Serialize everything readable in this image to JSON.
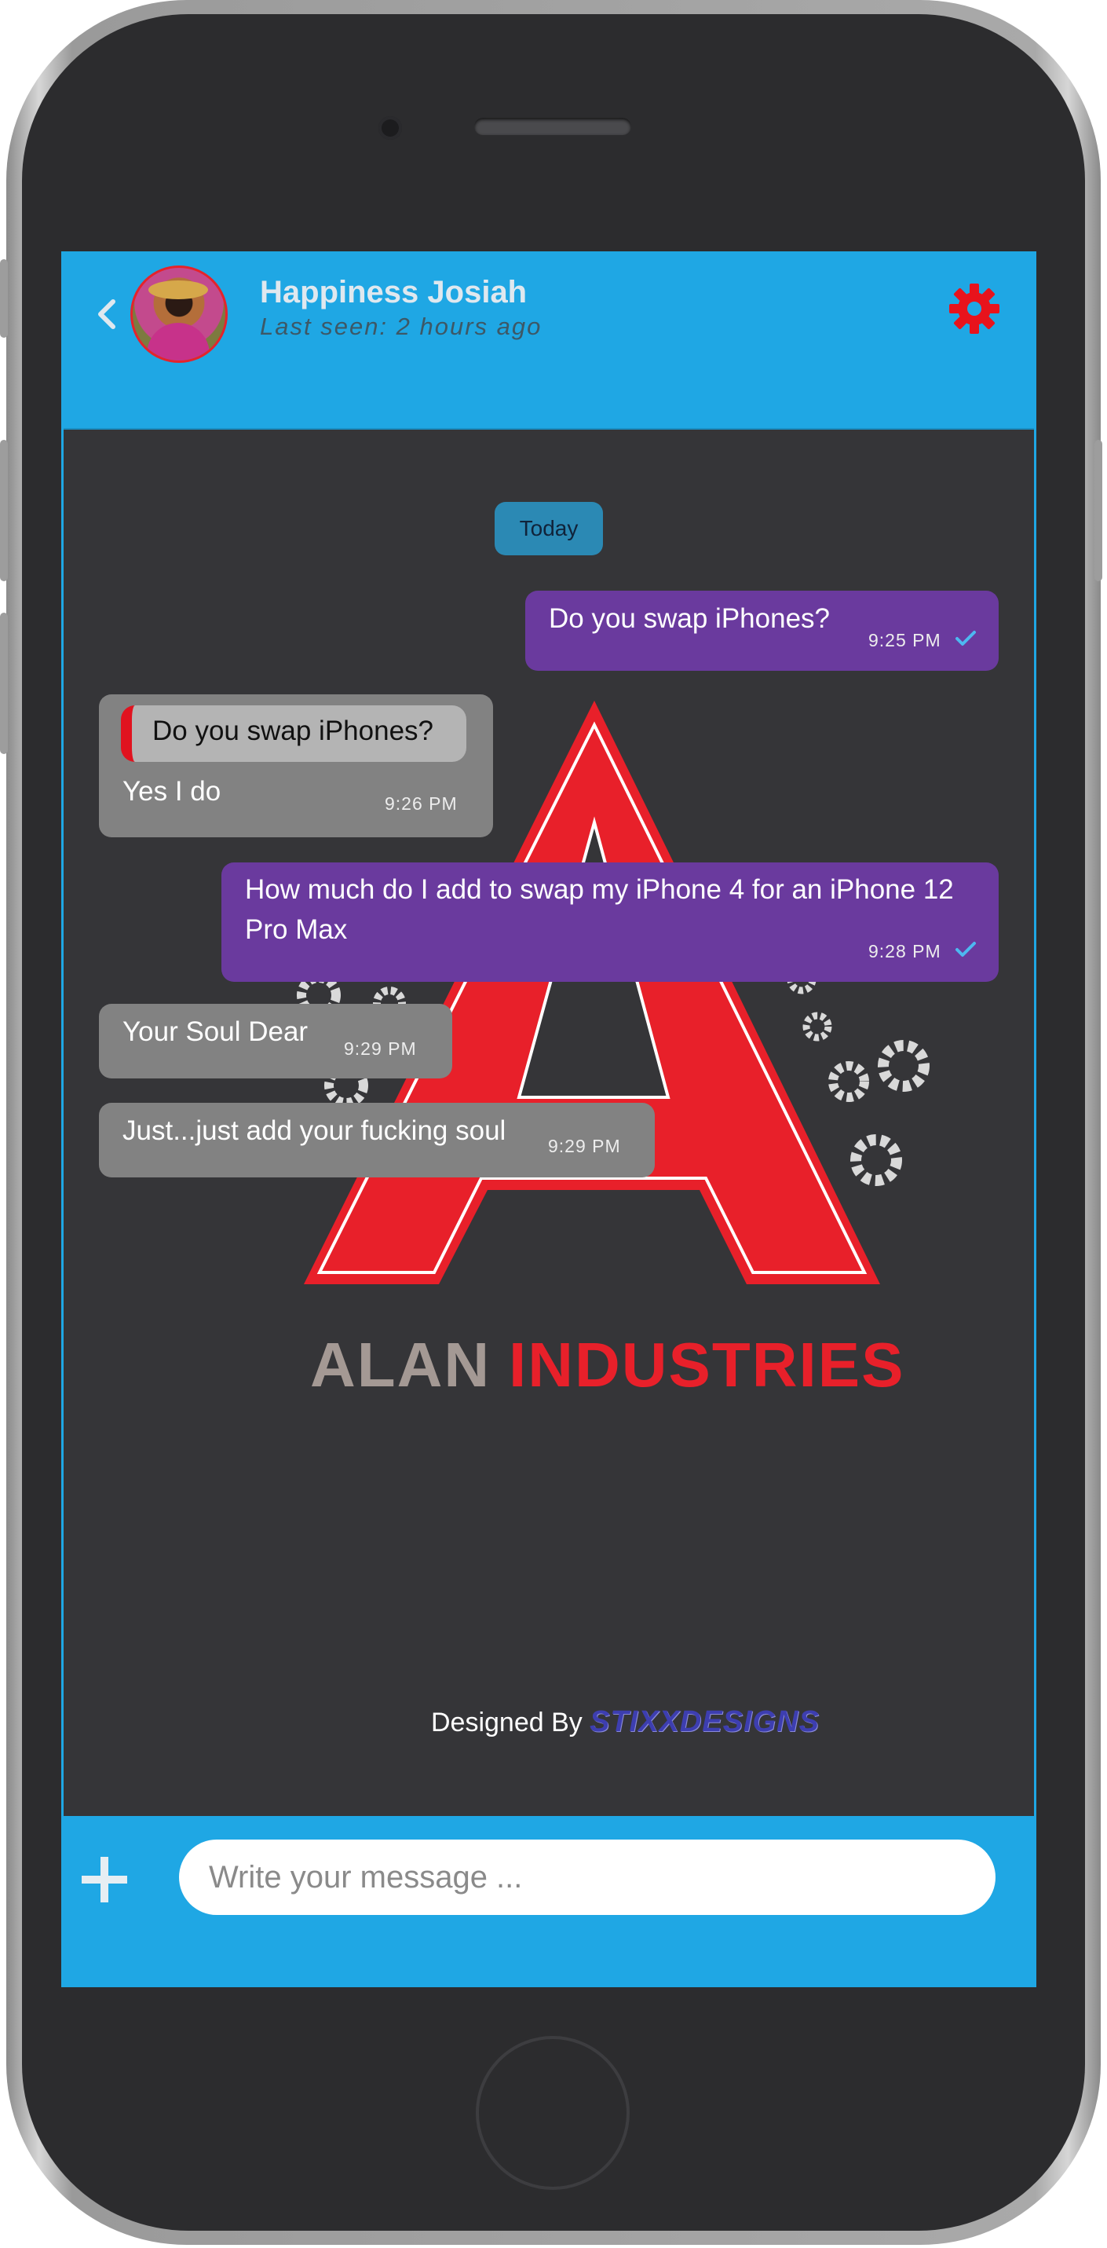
{
  "header": {
    "contact_name": "Happiness Josiah",
    "last_seen": "Last seen: 2 hours ago",
    "back_icon": "chevron-left-icon",
    "settings_icon": "gear-icon",
    "settings_color": "#e8131c"
  },
  "chat": {
    "date_label": "Today",
    "messages": [
      {
        "direction": "outgoing",
        "text": "Do you swap iPhones?",
        "time": "9:25 PM",
        "status": "read"
      },
      {
        "direction": "incoming",
        "reply_to": "Do you swap iPhones?",
        "text": "Yes I do",
        "time": "9:26 PM"
      },
      {
        "direction": "outgoing",
        "text": "How much do I add to swap my iPhone 4 for an iPhone 12 Pro Max",
        "time": "9:28 PM",
        "status": "read"
      },
      {
        "direction": "incoming",
        "text": "Your Soul Dear",
        "time": "9:29 PM"
      },
      {
        "direction": "incoming",
        "text": "Just...just add your fucking soul",
        "time": "9:29 PM"
      }
    ]
  },
  "watermark": {
    "brand_left": "ALAN",
    "brand_right": "INDUSTRIES",
    "designed_by": "Designed By",
    "designer": "STIXXDESIGNS"
  },
  "composer": {
    "add_icon": "plus-icon",
    "placeholder": "Write your message ..."
  },
  "colors": {
    "accent": "#1fa7e4",
    "outgoing_bubble": "#6a3a9e",
    "incoming_bubble": "#828282",
    "chat_background": "#353538",
    "brand_red": "#e8202a"
  }
}
